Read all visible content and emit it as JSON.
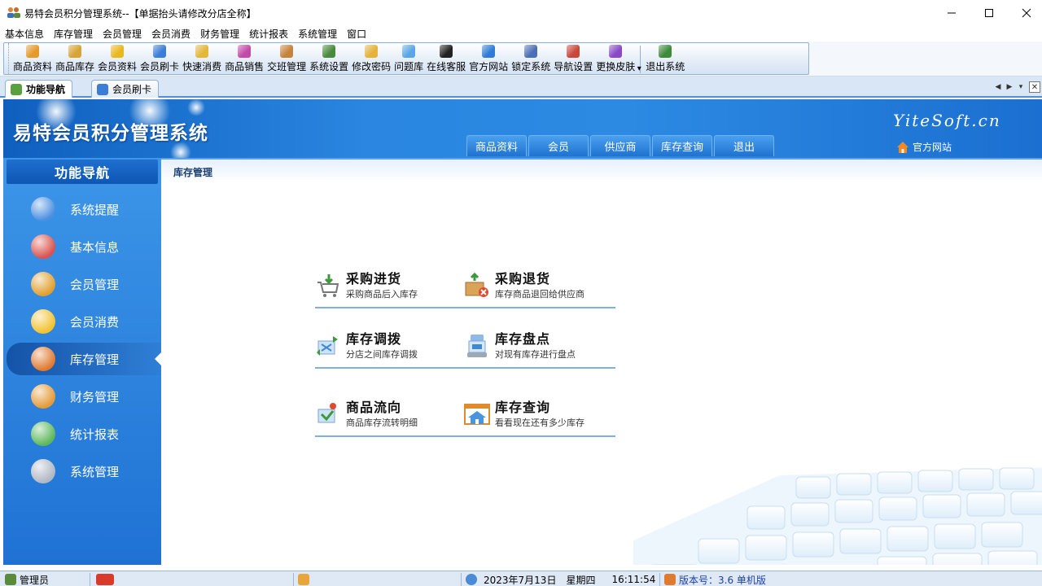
{
  "window": {
    "title": "易特会员积分管理系统--【单据抬头请修改分店全称】"
  },
  "menu": [
    "基本信息",
    "库存管理",
    "会员管理",
    "会员消费",
    "财务管理",
    "统计报表",
    "系统管理",
    "窗口"
  ],
  "toolbar": [
    {
      "label": "商品资料",
      "icon": "goods-icon",
      "color": "#e59a2c"
    },
    {
      "label": "商品库存",
      "icon": "stock-box-icon",
      "color": "#d6a437"
    },
    {
      "label": "会员资料",
      "icon": "member-coin-icon",
      "color": "#e8b820"
    },
    {
      "label": "会员刷卡",
      "icon": "card-swipe-icon",
      "color": "#3b7dd8"
    },
    {
      "label": "快速消费",
      "icon": "quick-consume-icon",
      "color": "#e2b73a"
    },
    {
      "label": "商品销售",
      "icon": "sales-icon",
      "color": "#c24aa8"
    },
    {
      "label": "交班管理",
      "icon": "shift-icon",
      "color": "#c7823c"
    },
    {
      "label": "系统设置",
      "icon": "settings-icon",
      "color": "#4a8a3c"
    },
    {
      "label": "修改密码",
      "icon": "pencil-icon",
      "color": "#e5b23a"
    },
    {
      "label": "问题库",
      "icon": "help-cloud-icon",
      "color": "#5aa6e6"
    },
    {
      "label": "在线客服",
      "icon": "qq-penguin-icon",
      "color": "#222222"
    },
    {
      "label": "官方网站",
      "icon": "ie-browser-icon",
      "color": "#2f7bd6"
    },
    {
      "label": "锁定系统",
      "icon": "lock-screen-icon",
      "color": "#4d6fb5"
    },
    {
      "label": "导航设置",
      "icon": "nav-settings-icon",
      "color": "#c9463b"
    },
    {
      "label": "更换皮肤",
      "icon": "skin-palette-icon",
      "color": "#8a49c7"
    },
    {
      "label": "退出系统",
      "icon": "exit-door-icon",
      "color": "#3c8a3a"
    }
  ],
  "tabs": [
    {
      "label": "功能导航",
      "icon": "home-tab-icon",
      "active": true
    },
    {
      "label": "会员刷卡",
      "icon": "card-tab-icon",
      "active": false
    }
  ],
  "banner": {
    "brand": "易特会员积分管理系统",
    "site": "YiteSoft.cn",
    "home_link": "官方网站",
    "tabs": [
      "商品资料",
      "会员",
      "供应商",
      "库存查询",
      "退出"
    ]
  },
  "nav": {
    "header": "功能导航",
    "items": [
      {
        "label": "系统提醒",
        "icon": "info-icon",
        "color": "#4b8fe0"
      },
      {
        "label": "基本信息",
        "icon": "cubes-icon",
        "color": "#d9534f"
      },
      {
        "label": "会员管理",
        "icon": "member-box-icon",
        "color": "#e0a030"
      },
      {
        "label": "会员消费",
        "icon": "chat-bubble-icon",
        "color": "#f2c230"
      },
      {
        "label": "库存管理",
        "icon": "warehouse-icon",
        "color": "#e07a30",
        "active": true
      },
      {
        "label": "财务管理",
        "icon": "finance-icon",
        "color": "#e49b3a"
      },
      {
        "label": "统计报表",
        "icon": "bar-chart-icon",
        "color": "#5cb85c"
      },
      {
        "label": "系统管理",
        "icon": "tools-icon",
        "color": "#b0b8c4"
      }
    ]
  },
  "content": {
    "title": "库存管理",
    "functions": [
      {
        "name": "采购进货",
        "desc": "采购商品后入库存",
        "icon": "purchase-cart-icon"
      },
      {
        "name": "采购退货",
        "desc": "库存商品退回给供应商",
        "icon": "return-box-icon"
      },
      {
        "name": "库存调拨",
        "desc": "分店之间库存调拨",
        "icon": "transfer-icon"
      },
      {
        "name": "库存盘点",
        "desc": "对现有库存进行盘点",
        "icon": "inventory-check-icon"
      },
      {
        "name": "商品流向",
        "desc": "商品库存流转明细",
        "icon": "flow-icon"
      },
      {
        "name": "库存查询",
        "desc": "看看现在还有多少库存",
        "icon": "stock-query-icon"
      }
    ]
  },
  "status": {
    "user": "管理员",
    "date": "2023年7月13日",
    "weekday": "星期四",
    "time": "16:11:54",
    "version": "版本号：3.6 单机版"
  }
}
